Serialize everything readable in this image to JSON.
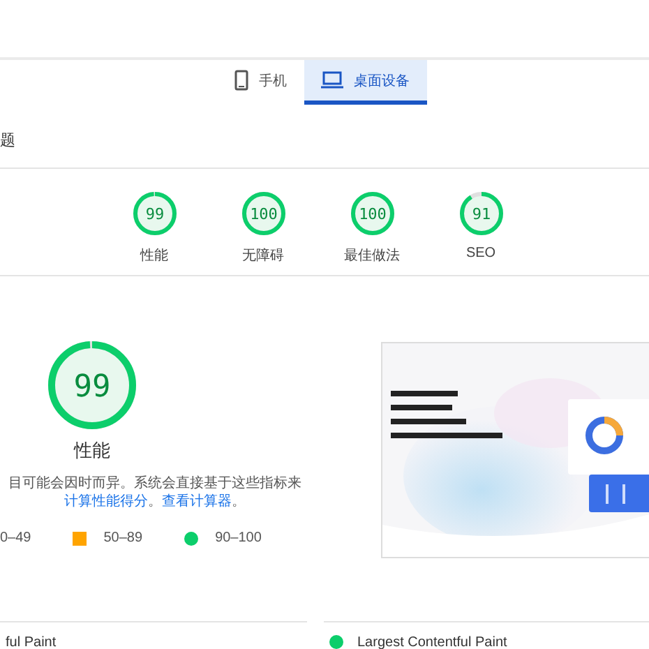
{
  "tabs": [
    {
      "label": "手机",
      "selected": false
    },
    {
      "label": "桌面设备",
      "selected": true
    }
  ],
  "section_heading": "题",
  "scores": [
    {
      "value": "99",
      "label": "性能"
    },
    {
      "value": "100",
      "label": "无障碍"
    },
    {
      "value": "100",
      "label": "最佳做法"
    },
    {
      "value": "91",
      "label": "SEO"
    }
  ],
  "performance": {
    "value": "99",
    "title": "性能",
    "description": [
      {
        "kind": "text",
        "text": "目可能会因时而异。系统会直接基于这些指标来"
      },
      {
        "kind": "link",
        "text": "计算性能"
      },
      {
        "kind": "link",
        "text": "得分"
      },
      {
        "kind": "text",
        "text": "。"
      },
      {
        "kind": "link",
        "text": "查看计算器"
      },
      {
        "kind": "text",
        "text": "。"
      }
    ],
    "legend": [
      {
        "kind": "none",
        "range": "0–49"
      },
      {
        "kind": "square",
        "range": "50–89",
        "color": "#ffa400"
      },
      {
        "kind": "circle",
        "range": "90–100",
        "color": "#0cce6b"
      }
    ]
  },
  "metrics": [
    {
      "label": "ful Paint"
    },
    {
      "label": "Largest Contentful Paint",
      "color": "#0cce6b"
    }
  ]
}
